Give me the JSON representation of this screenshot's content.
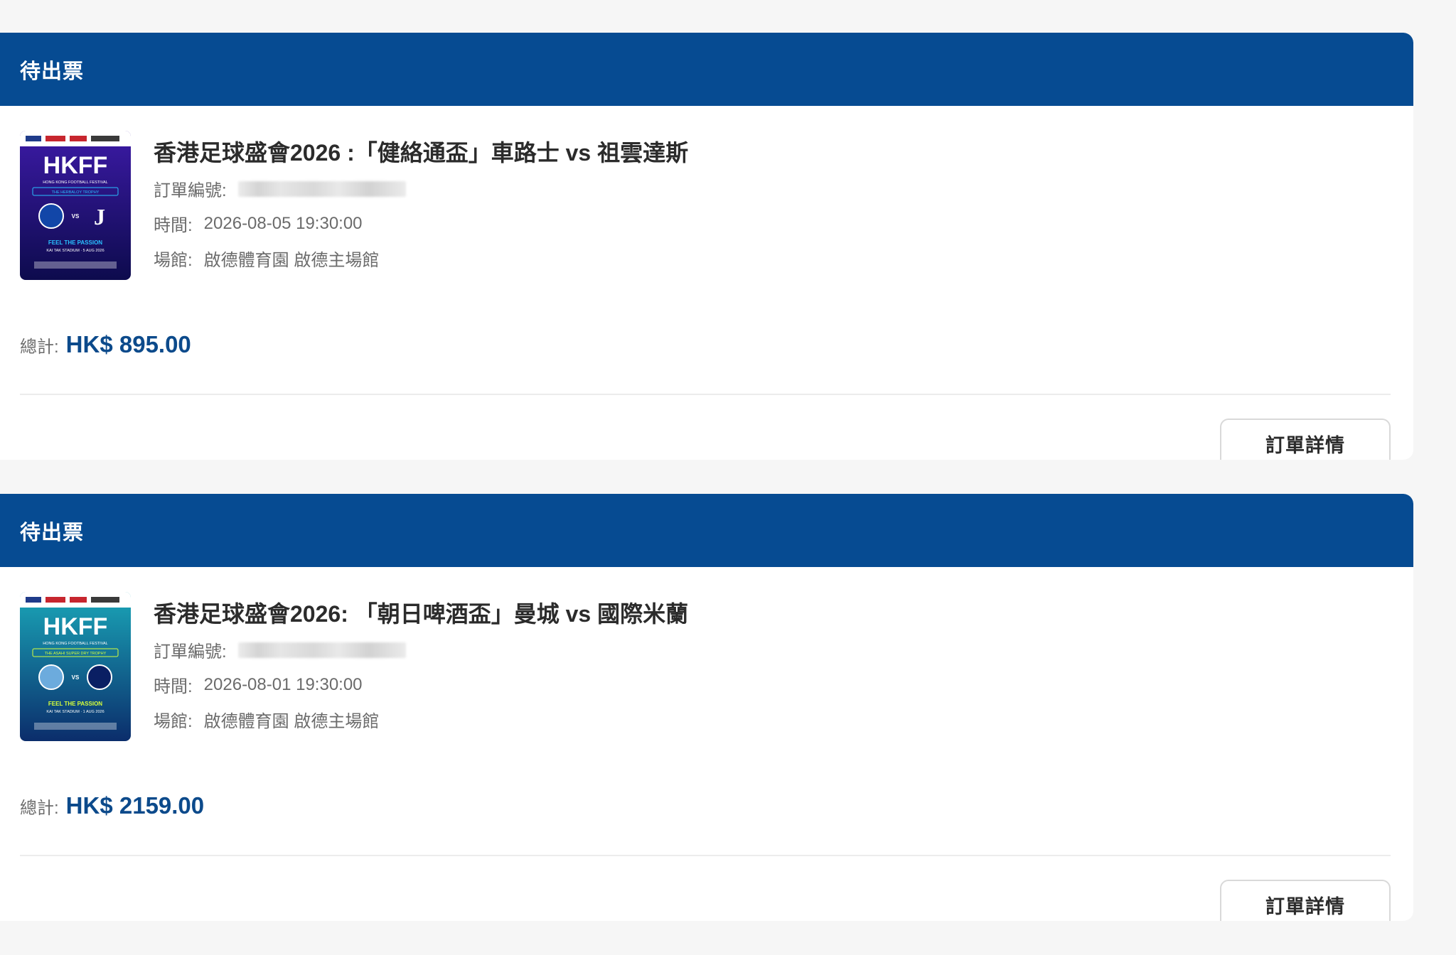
{
  "orders": [
    {
      "status": "待出票",
      "title": "香港足球盛會2026 :「健絡通盃」車路士 vs 祖雲達斯",
      "order_number_label": "訂單編號:",
      "time_label": "時間:",
      "time_value": "2026-08-05 19:30:00",
      "venue_label": "場館:",
      "venue_value": "啟德體育園 啟德主場館",
      "total_label": "總計:",
      "total_value": "HK$ 895.00",
      "detail_button": "訂單詳情",
      "poster": {
        "brand": "HKFF",
        "subtitle": "HONG KONG FOOTBALL FESTIVAL",
        "trophy": "THE HERBALOY TROPHY",
        "vs": "VS",
        "slogan": "FEEL THE PASSION",
        "venue_date": "KAI TAK STADIUM · 5 AUG 2026",
        "color_top": "#3c1aa6",
        "color_bottom": "#0d0b4d",
        "accent": "#29c0ff"
      }
    },
    {
      "status": "待出票",
      "title": "香港足球盛會2026: 「朝日啤酒盃」曼城 vs 國際米蘭",
      "order_number_label": "訂單編號:",
      "time_label": "時間:",
      "time_value": "2026-08-01 19:30:00",
      "venue_label": "場館:",
      "venue_value": "啟德體育園 啟德主場館",
      "total_label": "總計:",
      "total_value": "HK$ 2159.00",
      "detail_button": "訂單詳情",
      "poster": {
        "brand": "HKFF",
        "subtitle": "HONG KONG FOOTBALL FESTIVAL",
        "trophy": "THE ASAHI SUPER DRY TROPHY",
        "vs": "VS",
        "slogan": "FEEL THE PASSION",
        "venue_date": "KAI TAK STADIUM · 1 AUG 2026",
        "color_top": "#1aa6b8",
        "color_bottom": "#0b2d6b",
        "accent": "#d7ff3a"
      }
    }
  ]
}
